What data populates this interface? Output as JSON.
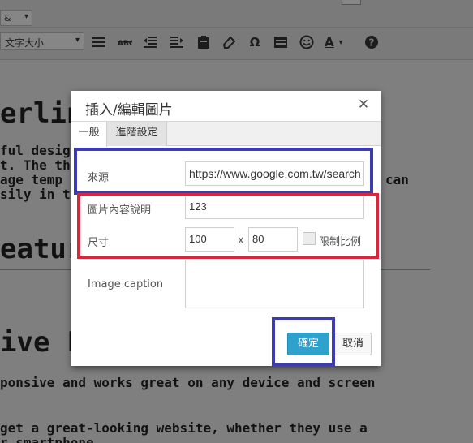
{
  "editor": {
    "format_select_value": "&",
    "font_size_select": "文字大小",
    "toolbar_icons": [
      "list-icon",
      "strikethrough-icon",
      "outdent-icon",
      "indent-icon",
      "paste-icon",
      "eraser-icon",
      "omega-icon",
      "table-icon",
      "emoji-icon",
      "text-color-icon",
      "help-icon"
    ],
    "omega_glyph": "Ω",
    "text_color_glyph": "A",
    "help_glyph": "?",
    "heading1": "erlin",
    "para1_line1": "ful design",
    "para1_line2": "t. The the",
    "para1_line3": "age temp",
    "para1_line4": "sily in the",
    "para1_right": "can",
    "heading2": "eatur",
    "heading3": "ive La",
    "para2": "ponsive and works great on any device and screen",
    "para3_line1": "get a great-looking website, whether they use a",
    "para3_line2": "r smartphone"
  },
  "dialog": {
    "title": "插入/編輯圖片",
    "close_glyph": "✕",
    "tabs": [
      {
        "label": "一般"
      },
      {
        "label": "進階設定"
      }
    ],
    "source_label": "來源",
    "source_value": "https://www.google.com.tw/search",
    "description_label": "圖片內容說明",
    "description_value": "123",
    "size_label": "尺寸",
    "width_value": "100",
    "times_glyph": "x",
    "height_value": "80",
    "constrain_label": "限制比例",
    "caption_label": "Image caption",
    "ok_label": "確定",
    "cancel_label": "取消"
  },
  "colors": {
    "overlay": "#7f7f7f",
    "accent_button": "#2ea2cc",
    "highlight_blue": "#3c3cb0",
    "highlight_red": "#d8263a"
  }
}
